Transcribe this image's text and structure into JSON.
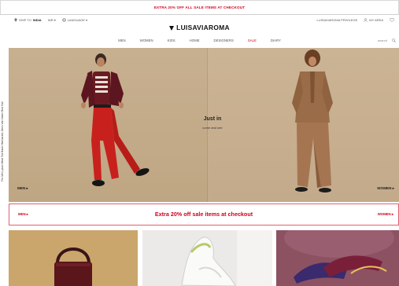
{
  "promo": {
    "text": "EXTRA 20% OFF ALL SALE ITEMS AT CHECKOUT"
  },
  "utility": {
    "ship_prefix": "SHIP TO",
    "ship_country": "INDIA",
    "currency": "INR ▾",
    "language": "LANGUAGE ▾",
    "privilege": "LUISAVIAROMA PRIVILEGE",
    "my_area": "MY AREA"
  },
  "brand": {
    "name": "LUISAVIAROMA"
  },
  "nav": {
    "items": [
      "MEN",
      "WOMEN",
      "KIDS",
      "HOME",
      "DESIGNERS",
      "SALE",
      "DIARY"
    ],
    "search_label": "search"
  },
  "hero": {
    "title": "Just in",
    "subtitle": "come and see",
    "men_label": "MEN ▸",
    "women_label": "WOMEN ▸",
    "side_caption": "For Men: plum Wool Ted Baker Hat/Jacket, Dries Van Noten Red Suit",
    "colors": {
      "left_bg": "#c7b090",
      "right_bg": "#cbb495"
    }
  },
  "sale_banner": {
    "men_label": "MEN ▸",
    "text": "Extra 20% off sale items at checkout",
    "women_label": "WOMEN ▸",
    "accent": "#d0021b"
  },
  "icons": {
    "location": "location-pin-icon",
    "globe": "globe-icon",
    "user": "user-icon",
    "heart": "heart-icon",
    "search": "search-icon",
    "bag": "shopping-bag-icon"
  }
}
